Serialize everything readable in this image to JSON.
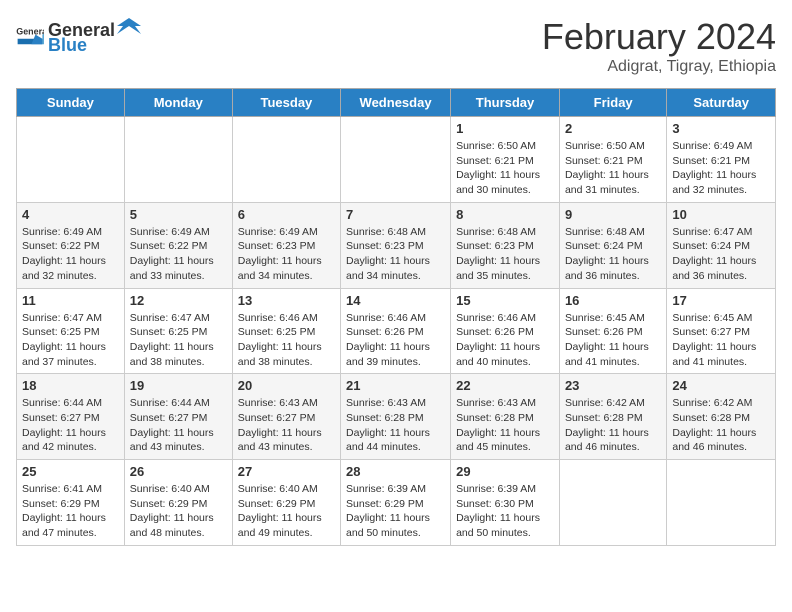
{
  "header": {
    "logo_general": "General",
    "logo_blue": "Blue",
    "month_title": "February 2024",
    "subtitle": "Adigrat, Tigray, Ethiopia"
  },
  "weekdays": [
    "Sunday",
    "Monday",
    "Tuesday",
    "Wednesday",
    "Thursday",
    "Friday",
    "Saturday"
  ],
  "weeks": [
    [
      {
        "day": "",
        "sunrise": "",
        "sunset": "",
        "daylight": ""
      },
      {
        "day": "",
        "sunrise": "",
        "sunset": "",
        "daylight": ""
      },
      {
        "day": "",
        "sunrise": "",
        "sunset": "",
        "daylight": ""
      },
      {
        "day": "",
        "sunrise": "",
        "sunset": "",
        "daylight": ""
      },
      {
        "day": "1",
        "sunrise": "Sunrise: 6:50 AM",
        "sunset": "Sunset: 6:21 PM",
        "daylight": "Daylight: 11 hours and 30 minutes."
      },
      {
        "day": "2",
        "sunrise": "Sunrise: 6:50 AM",
        "sunset": "Sunset: 6:21 PM",
        "daylight": "Daylight: 11 hours and 31 minutes."
      },
      {
        "day": "3",
        "sunrise": "Sunrise: 6:49 AM",
        "sunset": "Sunset: 6:21 PM",
        "daylight": "Daylight: 11 hours and 32 minutes."
      }
    ],
    [
      {
        "day": "4",
        "sunrise": "Sunrise: 6:49 AM",
        "sunset": "Sunset: 6:22 PM",
        "daylight": "Daylight: 11 hours and 32 minutes."
      },
      {
        "day": "5",
        "sunrise": "Sunrise: 6:49 AM",
        "sunset": "Sunset: 6:22 PM",
        "daylight": "Daylight: 11 hours and 33 minutes."
      },
      {
        "day": "6",
        "sunrise": "Sunrise: 6:49 AM",
        "sunset": "Sunset: 6:23 PM",
        "daylight": "Daylight: 11 hours and 34 minutes."
      },
      {
        "day": "7",
        "sunrise": "Sunrise: 6:48 AM",
        "sunset": "Sunset: 6:23 PM",
        "daylight": "Daylight: 11 hours and 34 minutes."
      },
      {
        "day": "8",
        "sunrise": "Sunrise: 6:48 AM",
        "sunset": "Sunset: 6:23 PM",
        "daylight": "Daylight: 11 hours and 35 minutes."
      },
      {
        "day": "9",
        "sunrise": "Sunrise: 6:48 AM",
        "sunset": "Sunset: 6:24 PM",
        "daylight": "Daylight: 11 hours and 36 minutes."
      },
      {
        "day": "10",
        "sunrise": "Sunrise: 6:47 AM",
        "sunset": "Sunset: 6:24 PM",
        "daylight": "Daylight: 11 hours and 36 minutes."
      }
    ],
    [
      {
        "day": "11",
        "sunrise": "Sunrise: 6:47 AM",
        "sunset": "Sunset: 6:25 PM",
        "daylight": "Daylight: 11 hours and 37 minutes."
      },
      {
        "day": "12",
        "sunrise": "Sunrise: 6:47 AM",
        "sunset": "Sunset: 6:25 PM",
        "daylight": "Daylight: 11 hours and 38 minutes."
      },
      {
        "day": "13",
        "sunrise": "Sunrise: 6:46 AM",
        "sunset": "Sunset: 6:25 PM",
        "daylight": "Daylight: 11 hours and 38 minutes."
      },
      {
        "day": "14",
        "sunrise": "Sunrise: 6:46 AM",
        "sunset": "Sunset: 6:26 PM",
        "daylight": "Daylight: 11 hours and 39 minutes."
      },
      {
        "day": "15",
        "sunrise": "Sunrise: 6:46 AM",
        "sunset": "Sunset: 6:26 PM",
        "daylight": "Daylight: 11 hours and 40 minutes."
      },
      {
        "day": "16",
        "sunrise": "Sunrise: 6:45 AM",
        "sunset": "Sunset: 6:26 PM",
        "daylight": "Daylight: 11 hours and 41 minutes."
      },
      {
        "day": "17",
        "sunrise": "Sunrise: 6:45 AM",
        "sunset": "Sunset: 6:27 PM",
        "daylight": "Daylight: 11 hours and 41 minutes."
      }
    ],
    [
      {
        "day": "18",
        "sunrise": "Sunrise: 6:44 AM",
        "sunset": "Sunset: 6:27 PM",
        "daylight": "Daylight: 11 hours and 42 minutes."
      },
      {
        "day": "19",
        "sunrise": "Sunrise: 6:44 AM",
        "sunset": "Sunset: 6:27 PM",
        "daylight": "Daylight: 11 hours and 43 minutes."
      },
      {
        "day": "20",
        "sunrise": "Sunrise: 6:43 AM",
        "sunset": "Sunset: 6:27 PM",
        "daylight": "Daylight: 11 hours and 43 minutes."
      },
      {
        "day": "21",
        "sunrise": "Sunrise: 6:43 AM",
        "sunset": "Sunset: 6:28 PM",
        "daylight": "Daylight: 11 hours and 44 minutes."
      },
      {
        "day": "22",
        "sunrise": "Sunrise: 6:43 AM",
        "sunset": "Sunset: 6:28 PM",
        "daylight": "Daylight: 11 hours and 45 minutes."
      },
      {
        "day": "23",
        "sunrise": "Sunrise: 6:42 AM",
        "sunset": "Sunset: 6:28 PM",
        "daylight": "Daylight: 11 hours and 46 minutes."
      },
      {
        "day": "24",
        "sunrise": "Sunrise: 6:42 AM",
        "sunset": "Sunset: 6:28 PM",
        "daylight": "Daylight: 11 hours and 46 minutes."
      }
    ],
    [
      {
        "day": "25",
        "sunrise": "Sunrise: 6:41 AM",
        "sunset": "Sunset: 6:29 PM",
        "daylight": "Daylight: 11 hours and 47 minutes."
      },
      {
        "day": "26",
        "sunrise": "Sunrise: 6:40 AM",
        "sunset": "Sunset: 6:29 PM",
        "daylight": "Daylight: 11 hours and 48 minutes."
      },
      {
        "day": "27",
        "sunrise": "Sunrise: 6:40 AM",
        "sunset": "Sunset: 6:29 PM",
        "daylight": "Daylight: 11 hours and 49 minutes."
      },
      {
        "day": "28",
        "sunrise": "Sunrise: 6:39 AM",
        "sunset": "Sunset: 6:29 PM",
        "daylight": "Daylight: 11 hours and 50 minutes."
      },
      {
        "day": "29",
        "sunrise": "Sunrise: 6:39 AM",
        "sunset": "Sunset: 6:30 PM",
        "daylight": "Daylight: 11 hours and 50 minutes."
      },
      {
        "day": "",
        "sunrise": "",
        "sunset": "",
        "daylight": ""
      },
      {
        "day": "",
        "sunrise": "",
        "sunset": "",
        "daylight": ""
      }
    ]
  ]
}
